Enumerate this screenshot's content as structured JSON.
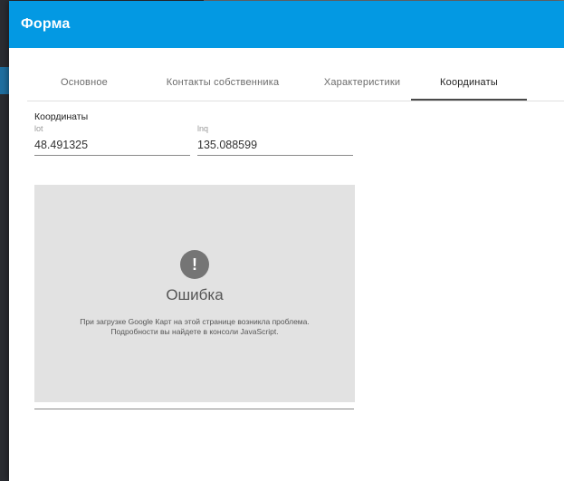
{
  "dialog": {
    "title": "Форма"
  },
  "tabs": [
    {
      "label": "Основное",
      "active": false
    },
    {
      "label": "Контакты собственника",
      "active": false
    },
    {
      "label": "Характеристики",
      "active": false
    },
    {
      "label": "Координаты",
      "active": true
    }
  ],
  "coordinates": {
    "section_label": "Координаты",
    "lat": {
      "label": "lot",
      "value": "48.491325"
    },
    "lng": {
      "label": "lnq",
      "value": "135.088599"
    }
  },
  "map": {
    "error_icon": "exclamation-icon",
    "error_title": "Ошибка",
    "error_message": "При загрузке Google Карт на этой странице возникла проблема. Подробности вы найдете в консоли JavaScript."
  },
  "colors": {
    "header": "#0399e3",
    "map_background": "#e2e2e2",
    "error_icon": "#757575"
  }
}
